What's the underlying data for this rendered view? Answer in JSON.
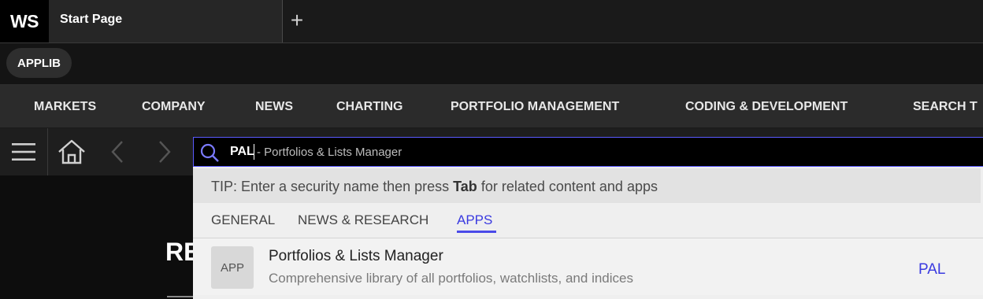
{
  "app": {
    "logo": "WS"
  },
  "tabs": [
    {
      "label": "Start Page"
    }
  ],
  "new_tab_label": "+",
  "applib": {
    "label": "APPLIB"
  },
  "nav": {
    "items": [
      "MARKETS",
      "COMPANY",
      "NEWS",
      "CHARTING",
      "PORTFOLIO MANAGEMENT",
      "CODING & DEVELOPMENT",
      "SEARCH T"
    ]
  },
  "search": {
    "query": "PAL",
    "suggestion": "- Portfolios & Lists Manager"
  },
  "dropdown": {
    "tip_prefix": "TIP: Enter a security name then press ",
    "tip_key": "Tab",
    "tip_suffix": " for related content and apps",
    "categories": [
      "GENERAL",
      "NEWS & RESEARCH",
      "APPS"
    ],
    "active_category": "APPS",
    "results": [
      {
        "badge": "APP",
        "title": "Portfolios & Lists Manager",
        "description": "Comprehensive library of all portfolios, watchlists, and indices",
        "code": "PAL"
      }
    ]
  },
  "background": {
    "heading": "RE"
  },
  "colors": {
    "accent": "#3a3ae0",
    "search_border": "#5a5aff"
  },
  "icons": [
    "hamburger-menu-icon",
    "home-icon",
    "back-arrow-icon",
    "forward-arrow-icon",
    "search-icon"
  ]
}
